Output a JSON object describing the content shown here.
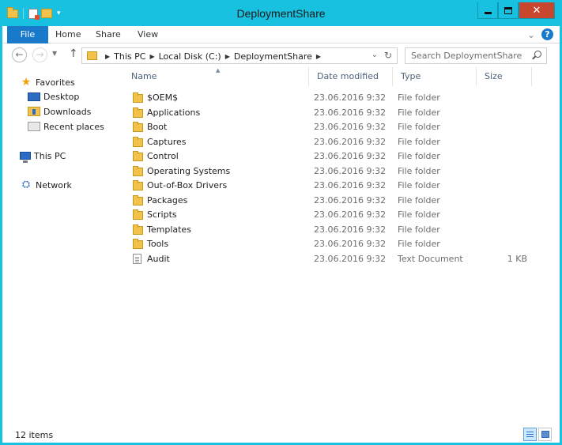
{
  "window": {
    "title": "DeploymentShare"
  },
  "ribbon": {
    "tabs": [
      "File",
      "Home",
      "Share",
      "View"
    ]
  },
  "address": {
    "crumbs": [
      "This PC",
      "Local Disk (C:)",
      "DeploymentShare"
    ],
    "search_placeholder": "Search DeploymentShare"
  },
  "nav": {
    "favorites_label": "Favorites",
    "favorites": [
      "Desktop",
      "Downloads",
      "Recent places"
    ],
    "this_pc": "This PC",
    "network": "Network"
  },
  "columns": {
    "name": "Name",
    "date": "Date modified",
    "type": "Type",
    "size": "Size"
  },
  "files": [
    {
      "name": "$OEM$",
      "date": "23.06.2016 9:32",
      "type": "File folder",
      "size": "",
      "kind": "folder"
    },
    {
      "name": "Applications",
      "date": "23.06.2016 9:32",
      "type": "File folder",
      "size": "",
      "kind": "folder"
    },
    {
      "name": "Boot",
      "date": "23.06.2016 9:32",
      "type": "File folder",
      "size": "",
      "kind": "folder"
    },
    {
      "name": "Captures",
      "date": "23.06.2016 9:32",
      "type": "File folder",
      "size": "",
      "kind": "folder"
    },
    {
      "name": "Control",
      "date": "23.06.2016 9:32",
      "type": "File folder",
      "size": "",
      "kind": "folder"
    },
    {
      "name": "Operating Systems",
      "date": "23.06.2016 9:32",
      "type": "File folder",
      "size": "",
      "kind": "folder"
    },
    {
      "name": "Out-of-Box Drivers",
      "date": "23.06.2016 9:32",
      "type": "File folder",
      "size": "",
      "kind": "folder"
    },
    {
      "name": "Packages",
      "date": "23.06.2016 9:32",
      "type": "File folder",
      "size": "",
      "kind": "folder"
    },
    {
      "name": "Scripts",
      "date": "23.06.2016 9:32",
      "type": "File folder",
      "size": "",
      "kind": "folder"
    },
    {
      "name": "Templates",
      "date": "23.06.2016 9:32",
      "type": "File folder",
      "size": "",
      "kind": "folder"
    },
    {
      "name": "Tools",
      "date": "23.06.2016 9:32",
      "type": "File folder",
      "size": "",
      "kind": "folder"
    },
    {
      "name": "Audit",
      "date": "23.06.2016 9:32",
      "type": "Text Document",
      "size": "1 KB",
      "kind": "document"
    }
  ],
  "status": {
    "item_count": "12 items"
  },
  "colors": {
    "accent": "#19c1e0",
    "file_tab": "#1979ca",
    "close": "#c7462d"
  }
}
